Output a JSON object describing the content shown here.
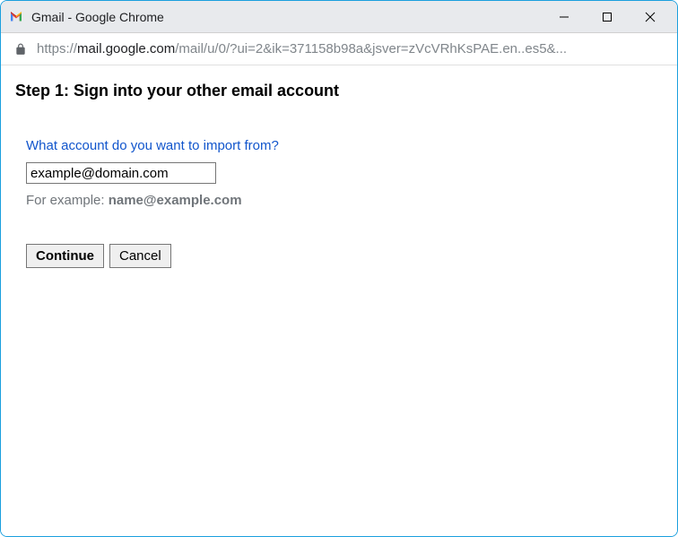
{
  "window": {
    "title": "Gmail - Google Chrome"
  },
  "addressbar": {
    "protocol": "https://",
    "domain": "mail.google.com",
    "path": "/mail/u/0/?ui=2&ik=371158b98a&jsver=zVcVRhKsPAE.en..es5&..."
  },
  "page": {
    "heading": "Step 1: Sign into your other email account",
    "question": "What account do you want to import from?",
    "email_value": "example@domain.com",
    "example_prefix": "For example: ",
    "example_email": "name@example.com",
    "continue_label": "Continue",
    "cancel_label": "Cancel"
  }
}
